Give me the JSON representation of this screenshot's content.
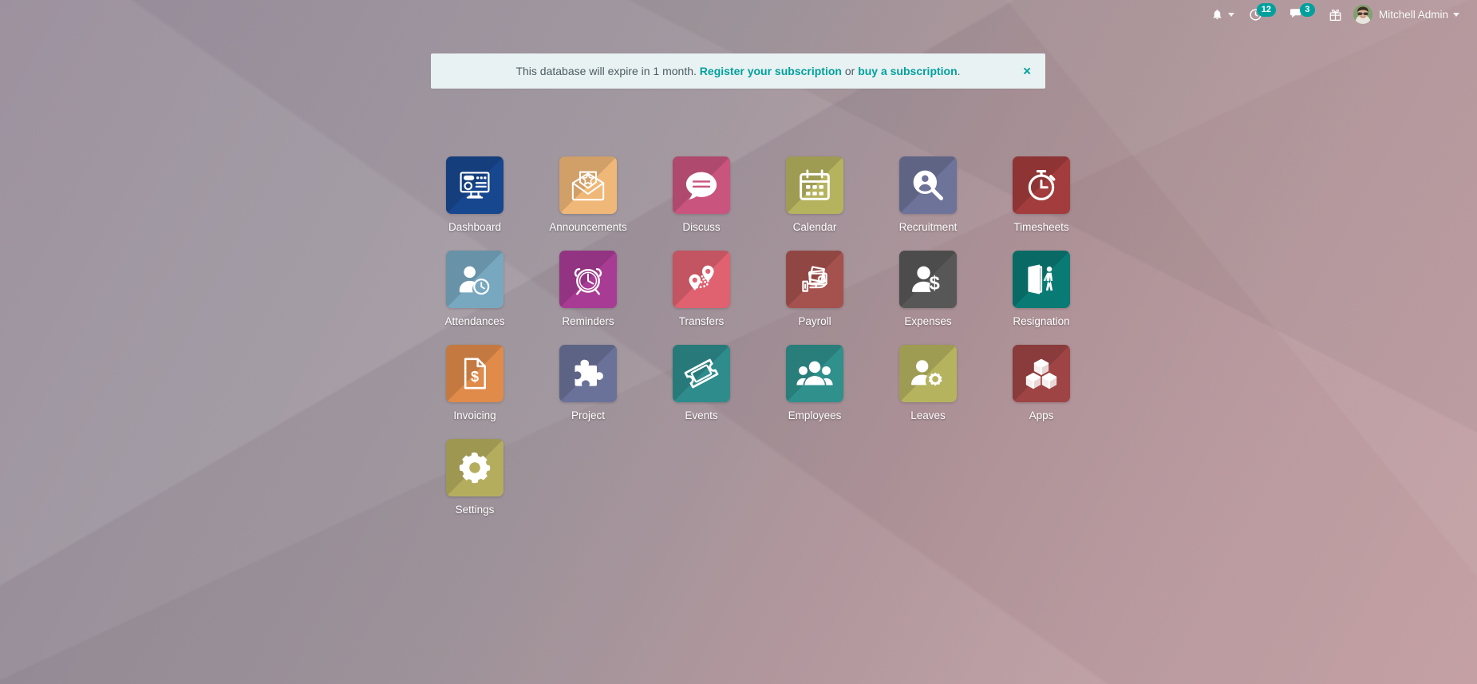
{
  "systray": {
    "activities": {
      "icon": "clock-activity-icon",
      "badge": "12"
    },
    "messages": {
      "icon": "chat-messages-icon",
      "badge": "3"
    },
    "gift": {
      "icon": "gift-icon"
    },
    "bell": {
      "icon": "bell-icon"
    },
    "user": {
      "name": "Mitchell Admin",
      "avatar": "user-avatar"
    }
  },
  "banner": {
    "text_before": "This database will expire in 1 month.",
    "link_register": "Register your subscription",
    "text_or": "or",
    "link_buy": "buy a subscription",
    "text_end": ".",
    "close_label": "×",
    "background": "#e9f2f3",
    "link_color": "#00a09d"
  },
  "apps": [
    {
      "name": "Dashboard",
      "icon": "dashboard-monitor-icon",
      "color": "#17478f"
    },
    {
      "name": "Announcements",
      "icon": "envelope-badge-icon",
      "color": "#f0b878"
    },
    {
      "name": "Discuss",
      "icon": "speech-bubble-icon",
      "color": "#c9547e"
    },
    {
      "name": "Calendar",
      "icon": "calendar-icon",
      "color": "#b6b35f"
    },
    {
      "name": "Recruitment",
      "icon": "magnifier-person-icon",
      "color": "#6d7399"
    },
    {
      "name": "Timesheets",
      "icon": "stopwatch-icon",
      "color": "#a33c3c"
    },
    {
      "name": "Attendances",
      "icon": "person-clock-icon",
      "color": "#78a8c0"
    },
    {
      "name": "Reminders",
      "icon": "alarm-clock-icon",
      "color": "#a83c94"
    },
    {
      "name": "Transfers",
      "icon": "map-pins-route-icon",
      "color": "#e0616f"
    },
    {
      "name": "Payroll",
      "icon": "hand-cash-icon",
      "color": "#a5514e"
    },
    {
      "name": "Expenses",
      "icon": "person-dollar-icon",
      "color": "#575757"
    },
    {
      "name": "Resignation",
      "icon": "door-exit-person-icon",
      "color": "#0a7a74"
    },
    {
      "name": "Invoicing",
      "icon": "invoice-dollar-icon",
      "color": "#e08b4a"
    },
    {
      "name": "Project",
      "icon": "puzzle-piece-icon",
      "color": "#6b7299"
    },
    {
      "name": "Events",
      "icon": "ticket-icon",
      "color": "#2e8c8c"
    },
    {
      "name": "Employees",
      "icon": "people-group-icon",
      "color": "#2f908c"
    },
    {
      "name": "Leaves",
      "icon": "person-gear-icon",
      "color": "#b5b35e"
    },
    {
      "name": "Apps",
      "icon": "cubes-icon",
      "color": "#9e4444"
    },
    {
      "name": "Settings",
      "icon": "gear-icon",
      "color": "#b5ad5e"
    }
  ],
  "background": {
    "base_color": "#9e919a",
    "accent_color": "#cfa9ad"
  }
}
